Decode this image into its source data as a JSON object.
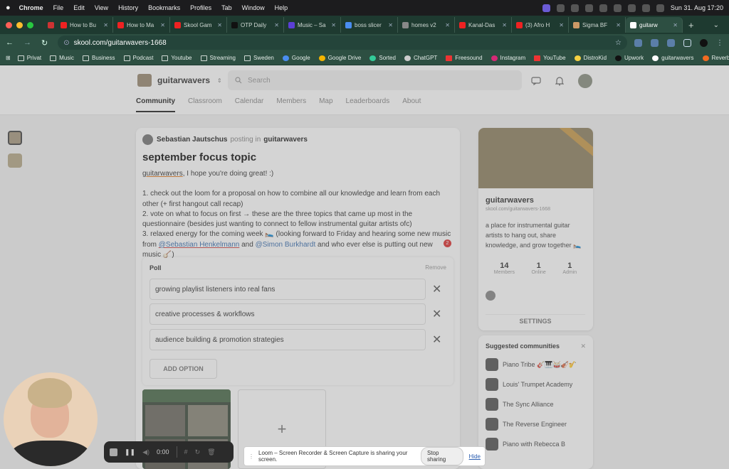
{
  "menubar": {
    "app": "Chrome",
    "items": [
      "File",
      "Edit",
      "View",
      "History",
      "Bookmarks",
      "Profiles",
      "Tab",
      "Window",
      "Help"
    ],
    "clock": "Sun 31. Aug  17:20"
  },
  "tabs": [
    {
      "label": "How to Bu"
    },
    {
      "label": "How to Ma"
    },
    {
      "label": "Skool Gam"
    },
    {
      "label": "OTP Daily"
    },
    {
      "label": "Music – Sa"
    },
    {
      "label": "boss slicer"
    },
    {
      "label": "homes v2"
    },
    {
      "label": "Kanal-Das"
    },
    {
      "label": "(3) Afro H"
    },
    {
      "label": "Sigma BF"
    },
    {
      "label": "guitarw"
    }
  ],
  "address": {
    "url": "skool.com/guitarwavers-1668"
  },
  "bookmarks": [
    "Privat",
    "Music",
    "Business",
    "Podcast",
    "Youtube",
    "Streaming",
    "Sweden",
    "Google",
    "Google Drive",
    "Sorted",
    "ChatGPT",
    "Freesound",
    "Instagram",
    "YouTube",
    "DistroKid",
    "Upwork",
    "guitarwavers",
    "Reverb"
  ],
  "skool": {
    "group_name": "guitarwavers",
    "search_placeholder": "Search",
    "nav": [
      "Community",
      "Classroom",
      "Calendar",
      "Members",
      "Map",
      "Leaderboards",
      "About"
    ]
  },
  "post": {
    "author": "Sebastian Jautschus",
    "posting_in": "posting in",
    "group": "guitarwavers",
    "title": "september focus topic",
    "greeting_mention": "guitarwavers",
    "greeting_rest": ", I hope you're doing great! :)",
    "line1": "1. check out the loom for a proposal on how to combine all our knowledge and learn from each other (+ first hangout call recap)",
    "line2": "2. vote on what to focus on first → these are the three topics that came up most in the questionnaire (besides just wanting to connect to fellow instrumental guitar artists ofc)",
    "line3a": "3. relaxed energy for the coming week 🛌 (looking forward to Friday and hearing some new music from ",
    "mention1": "@Sebastian Henkelmann",
    "and": " and ",
    "mention2": "@Simon Burkhardt",
    "line3b": " and who ever else is putting out new music 🪕)",
    "notif_badge": "2"
  },
  "poll": {
    "heading": "Poll",
    "remove": "Remove",
    "options": [
      "growing playlist listeners into real fans",
      "creative processes & workflows",
      "audience building & promotion strategies"
    ],
    "add_option": "ADD OPTION"
  },
  "community_card": {
    "name": "guitarwavers",
    "url": "skool.com/guitarwavers-1668",
    "description": "a place for instrumental guitar artists to hang out, share knowledge, and grow together 🛌",
    "stats": [
      {
        "value": "14",
        "label": "Members"
      },
      {
        "value": "1",
        "label": "Online"
      },
      {
        "value": "1",
        "label": "Admin"
      }
    ],
    "settings": "SETTINGS"
  },
  "suggested": {
    "heading": "Suggested communities",
    "items": [
      "Piano Tribe 🎸🎹🥁🎻🎷",
      "Louis' Trumpet Academy",
      "The Sync Alliance",
      "The Reverse Engineer",
      "Piano with Rebecca B"
    ]
  },
  "loom": {
    "timer": "0:00",
    "share_text": "Loom – Screen Recorder & Screen Capture is sharing your screen.",
    "stop": "Stop sharing",
    "hide": "Hide"
  }
}
